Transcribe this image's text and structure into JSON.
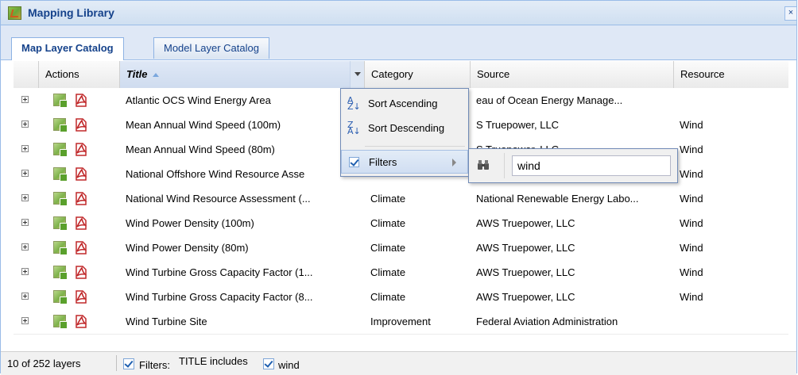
{
  "window": {
    "title": "Mapping Library",
    "close_label": "×"
  },
  "tabs": [
    {
      "label": "Map Layer Catalog",
      "active": true
    },
    {
      "label": "Model Layer Catalog",
      "active": false
    }
  ],
  "columns": {
    "actions": "Actions",
    "title": "Title",
    "category": "Category",
    "source": "Source",
    "resource": "Resource"
  },
  "rows": [
    {
      "title": "Atlantic OCS Wind Energy Area",
      "category": "",
      "source": "eau of Ocean Energy Manage...",
      "resource": ""
    },
    {
      "title": "Mean Annual Wind Speed (100m)",
      "category": "",
      "source": "S Truepower, LLC",
      "resource": "Wind"
    },
    {
      "title": "Mean Annual Wind Speed (80m)",
      "category": "",
      "source": "S Truepower, LLC",
      "resource": "Wind"
    },
    {
      "title": "National Offshore Wind Resource Asse",
      "category": "",
      "source": "",
      "resource": "Wind"
    },
    {
      "title": "National Wind Resource Assessment (...",
      "category": "Climate",
      "source": "National Renewable Energy Labo...",
      "resource": "Wind"
    },
    {
      "title": "Wind Power Density (100m)",
      "category": "Climate",
      "source": "AWS Truepower, LLC",
      "resource": "Wind"
    },
    {
      "title": "Wind Power Density (80m)",
      "category": "Climate",
      "source": "AWS Truepower, LLC",
      "resource": "Wind"
    },
    {
      "title": "Wind Turbine Gross Capacity Factor (1...",
      "category": "Climate",
      "source": "AWS Truepower, LLC",
      "resource": "Wind"
    },
    {
      "title": "Wind Turbine Gross Capacity Factor (8...",
      "category": "Climate",
      "source": "AWS Truepower, LLC",
      "resource": "Wind"
    },
    {
      "title": "Wind Turbine Site",
      "category": "Improvement",
      "source": "Federal Aviation Administration",
      "resource": ""
    }
  ],
  "column_menu": {
    "sort_ascending": "Sort Ascending",
    "sort_descending": "Sort Descending",
    "filters": "Filters"
  },
  "filter_submenu": {
    "value": "wind"
  },
  "status": {
    "count": "10 of 252 layers",
    "filters_label": "Filters:",
    "filter_desc": "TITLE includes",
    "filter_value": "wind"
  },
  "colors": {
    "header_blue": "#15428b",
    "border_blue": "#99bbe8",
    "tab_bg": "#dfe8f6"
  }
}
